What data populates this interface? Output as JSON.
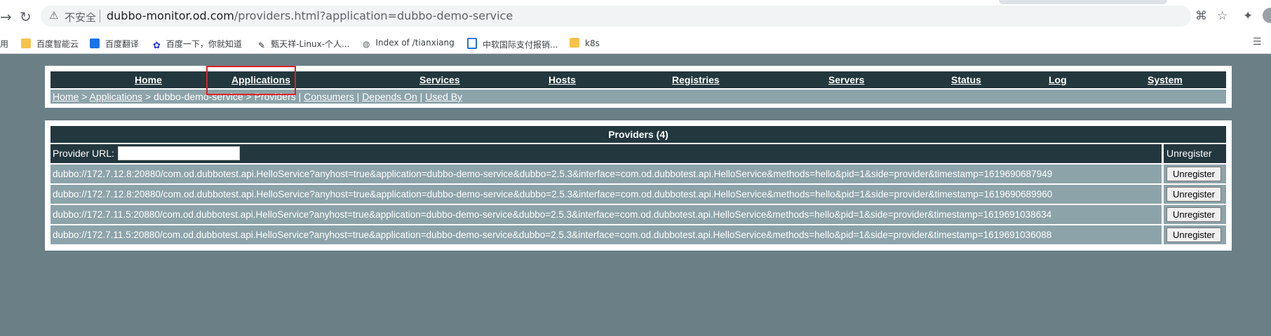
{
  "browser": {
    "insecure_label": "不安全",
    "url_host": "dubbo-monitor.od.com",
    "url_path": "/providers.html?application=dubbo-demo-service",
    "left_fragment": "用"
  },
  "bookmarks": [
    {
      "label": "百度智能云"
    },
    {
      "label": "百度翻译"
    },
    {
      "label": "百度一下，你就知道"
    },
    {
      "label": "甄天祥-Linux-个人..."
    },
    {
      "label": "Index of /tianxiang"
    },
    {
      "label": "中软国际支付报销..."
    },
    {
      "label": "k8s"
    }
  ],
  "nav": {
    "items": [
      {
        "label": "Home"
      },
      {
        "label": "Applications"
      },
      {
        "label": "Services"
      },
      {
        "label": "Hosts"
      },
      {
        "label": "Registries"
      },
      {
        "label": "Servers"
      },
      {
        "label": "Status"
      },
      {
        "label": "Log"
      },
      {
        "label": "System"
      }
    ]
  },
  "breadcrumb": {
    "home": "Home",
    "sep1": " > ",
    "applications": "Applications",
    "sep2": " > ",
    "app_name": "dubbo-demo-service",
    "sep3": " > ",
    "current": "Providers",
    "sep4": " | ",
    "consumers": "Consumers",
    "sep5": " | ",
    "depends_on": "Depends On",
    "sep6": " | ",
    "used_by": "Used By"
  },
  "providers": {
    "title": "Providers (4)",
    "filter_label": "Provider URL:",
    "filter_value": "",
    "action_header": "Unregister",
    "rows": [
      {
        "url": "dubbo://172.7.12.8:20880/com.od.dubbotest.api.HelloService?anyhost=true&application=dubbo-demo-service&dubbo=2.5.3&interface=com.od.dubbotest.api.HelloService&methods=hello&pid=1&side=provider&timestamp=1619690687949",
        "action": "Unregister"
      },
      {
        "url": "dubbo://172.7.12.8:20880/com.od.dubbotest.api.HelloService?anyhost=true&application=dubbo-demo-service&dubbo=2.5.3&interface=com.od.dubbotest.api.HelloService&methods=hello&pid=1&side=provider&timestamp=1619690689960",
        "action": "Unregister"
      },
      {
        "url": "dubbo://172.7.11.5:20880/com.od.dubbotest.api.HelloService?anyhost=true&application=dubbo-demo-service&dubbo=2.5.3&interface=com.od.dubbotest.api.HelloService&methods=hello&pid=1&side=provider&timestamp=1619691038634",
        "action": "Unregister"
      },
      {
        "url": "dubbo://172.7.11.5:20880/com.od.dubbotest.api.HelloService?anyhost=true&application=dubbo-demo-service&dubbo=2.5.3&interface=com.od.dubbotest.api.HelloService&methods=hello&pid=1&side=provider&timestamp=1619691036088",
        "action": "Unregister"
      }
    ]
  }
}
